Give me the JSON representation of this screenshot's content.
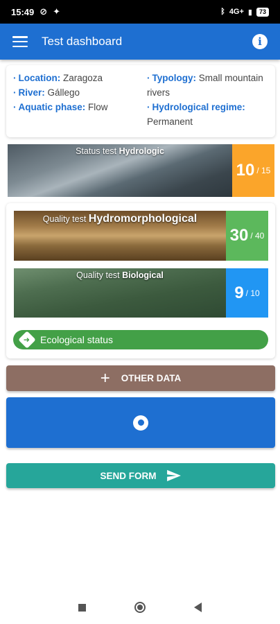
{
  "status_bar": {
    "time": "15:49",
    "signal": "4G+",
    "battery": "73"
  },
  "app_bar": {
    "title": "Test dashboard"
  },
  "info": {
    "location": {
      "label": "Location:",
      "value": "Zaragoza"
    },
    "river": {
      "label": "River:",
      "value": "Gállego"
    },
    "aquatic_phase": {
      "label": "Aquatic phase:",
      "value": "Flow"
    },
    "typology": {
      "label": "Typology:",
      "value": "Small mountain rivers"
    },
    "hydrological_regime": {
      "label": "Hydrological regime:",
      "value": "Permanent"
    }
  },
  "tests": {
    "hydrologic": {
      "prefix": "Status test",
      "name": "Hydrologic",
      "score": "10",
      "max": "/ 15",
      "color": "#fba52a"
    },
    "hydromorphological": {
      "prefix": "Quality test",
      "name": "Hydromorphological",
      "score": "30",
      "max": "/ 40",
      "color": "#5cb85c"
    },
    "biological": {
      "prefix": "Quality test",
      "name": "Biological",
      "score": "9",
      "max": "/ 10",
      "color": "#2196f3"
    }
  },
  "ecological_status": {
    "label": "Ecological status",
    "color": "#43a047"
  },
  "buttons": {
    "other_data": "OTHER DATA",
    "send_form": "SEND FORM"
  },
  "colors": {
    "primary": "#1e6fd1",
    "other_data_bg": "#8d6e63",
    "send_form_bg": "#26a69a"
  }
}
